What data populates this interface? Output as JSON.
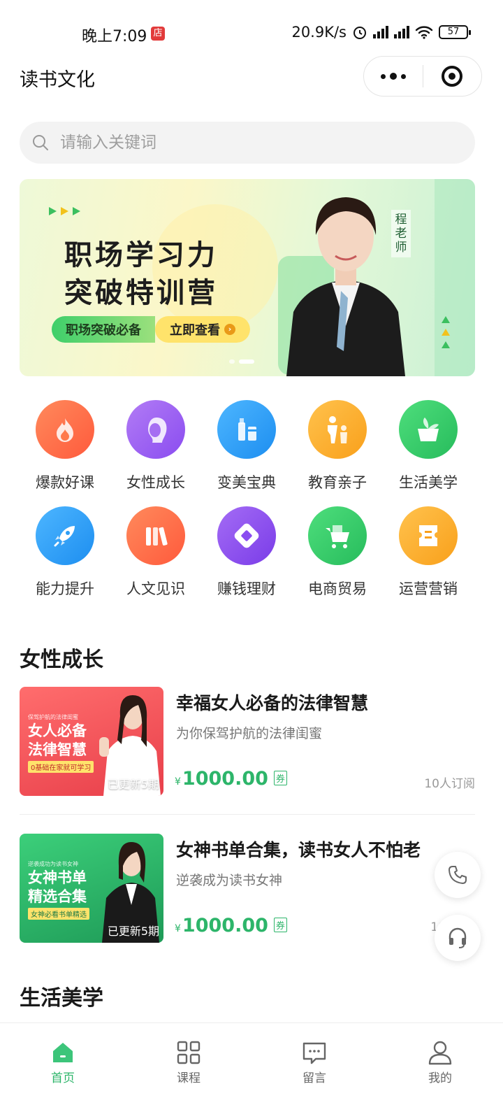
{
  "status_bar": {
    "time": "晚上7:09",
    "shop_badge": "店",
    "speed": "20.9K/s",
    "battery": "57"
  },
  "header": {
    "title": "读书文化"
  },
  "search": {
    "placeholder": "请输入关键词"
  },
  "banner": {
    "title_line1": "职场学习力",
    "title_line2": "突破特训营",
    "pill_left": "职场突破必备",
    "pill_right": "立即查看",
    "teacher_name": "程老师",
    "active_slide": 2,
    "slide_count": 2
  },
  "categories": [
    {
      "label": "爆款好课",
      "icon": "flame-icon",
      "color": "#ff6b45"
    },
    {
      "label": "女性成长",
      "icon": "woman-icon",
      "color": "#9b5cf0"
    },
    {
      "label": "变美宝典",
      "icon": "cosmetics-icon",
      "color": "#2e9ef5"
    },
    {
      "label": "教育亲子",
      "icon": "parent-child-icon",
      "color": "#fbae2a"
    },
    {
      "label": "生活美学",
      "icon": "plant-pot-icon",
      "color": "#34c868"
    },
    {
      "label": "能力提升",
      "icon": "rocket-icon",
      "color": "#2e9ef5"
    },
    {
      "label": "人文见识",
      "icon": "books-icon",
      "color": "#ff6b45"
    },
    {
      "label": "赚钱理财",
      "icon": "diamond-coin-icon",
      "color": "#8a4cf0"
    },
    {
      "label": "电商贸易",
      "icon": "shopping-cart-icon",
      "color": "#34c868"
    },
    {
      "label": "运营营销",
      "icon": "ticket-icon",
      "color": "#fbae2a"
    }
  ],
  "sections": [
    {
      "title": "女性成长",
      "courses": [
        {
          "title": "幸福女人必备的法律智慧",
          "subtitle": "为你保驾护航的法律闺蜜",
          "currency": "¥",
          "price": "1000.00",
          "coupon": "券",
          "subscribers": "10人订阅",
          "thumb_big_line1": "女人必备",
          "thumb_big_line2": "法律智慧",
          "thumb_tag": "0基础在家就可学习",
          "thumb_mini": "保驾护航的法律闺蜜",
          "thumb_update": "已更新5期"
        },
        {
          "title": "女神书单合集，读书女人不怕老",
          "subtitle": "逆袭成为读书女神",
          "currency": "¥",
          "price": "1000.00",
          "coupon": "券",
          "subscribers": "10",
          "thumb_big_line1": "女神书单",
          "thumb_big_line2": "精选合集",
          "thumb_tag": "女神必看书单精选",
          "thumb_mini": "逆袭成功为读书女神",
          "thumb_update": "已更新5期"
        }
      ]
    },
    {
      "title": "生活美学"
    }
  ],
  "tabbar": [
    {
      "label": "首页",
      "icon": "home-icon",
      "active": true
    },
    {
      "label": "课程",
      "icon": "grid-icon",
      "active": false
    },
    {
      "label": "留言",
      "icon": "message-icon",
      "active": false
    },
    {
      "label": "我的",
      "icon": "user-icon",
      "active": false
    }
  ],
  "colors": {
    "accent": "#2db56a",
    "text_primary": "#1a1a1a",
    "text_secondary": "#777777"
  }
}
